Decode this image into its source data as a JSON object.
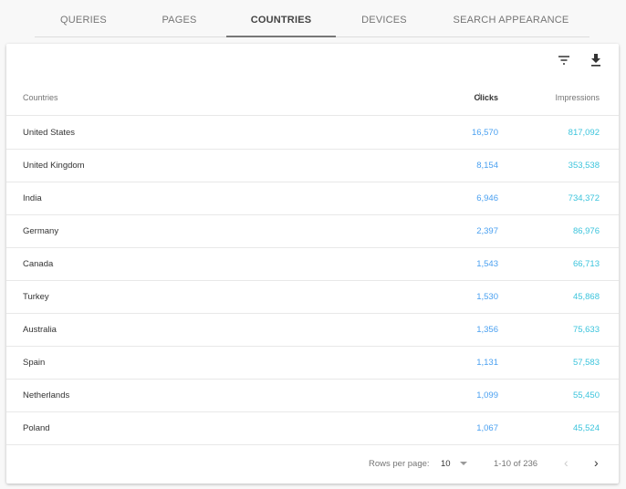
{
  "tabs": [
    "QUERIES",
    "PAGES",
    "COUNTRIES",
    "DEVICES",
    "SEARCH APPEARANCE"
  ],
  "active_tab": "COUNTRIES",
  "toolbar": {
    "filter_icon": "filter-icon",
    "download_icon": "download-icon"
  },
  "table": {
    "headers": {
      "country": "Countries",
      "clicks": "Clicks",
      "impressions": "Impressions",
      "sort": "descending by Clicks"
    },
    "rows": [
      {
        "country": "United States",
        "clicks": "16,570",
        "impressions": "817,092"
      },
      {
        "country": "United Kingdom",
        "clicks": "8,154",
        "impressions": "353,538"
      },
      {
        "country": "India",
        "clicks": "6,946",
        "impressions": "734,372"
      },
      {
        "country": "Germany",
        "clicks": "2,397",
        "impressions": "86,976"
      },
      {
        "country": "Canada",
        "clicks": "1,543",
        "impressions": "66,713"
      },
      {
        "country": "Turkey",
        "clicks": "1,530",
        "impressions": "45,868"
      },
      {
        "country": "Australia",
        "clicks": "1,356",
        "impressions": "75,633"
      },
      {
        "country": "Spain",
        "clicks": "1,131",
        "impressions": "57,583"
      },
      {
        "country": "Netherlands",
        "clicks": "1,099",
        "impressions": "55,450"
      },
      {
        "country": "Poland",
        "clicks": "1,067",
        "impressions": "45,524"
      }
    ]
  },
  "pagination": {
    "rows_per_page_label": "Rows per page:",
    "rows_per_page": "10",
    "range": "1-10 of 236"
  },
  "colors": {
    "clicks": "#4aa0f0",
    "impressions": "#3cc4dc"
  }
}
